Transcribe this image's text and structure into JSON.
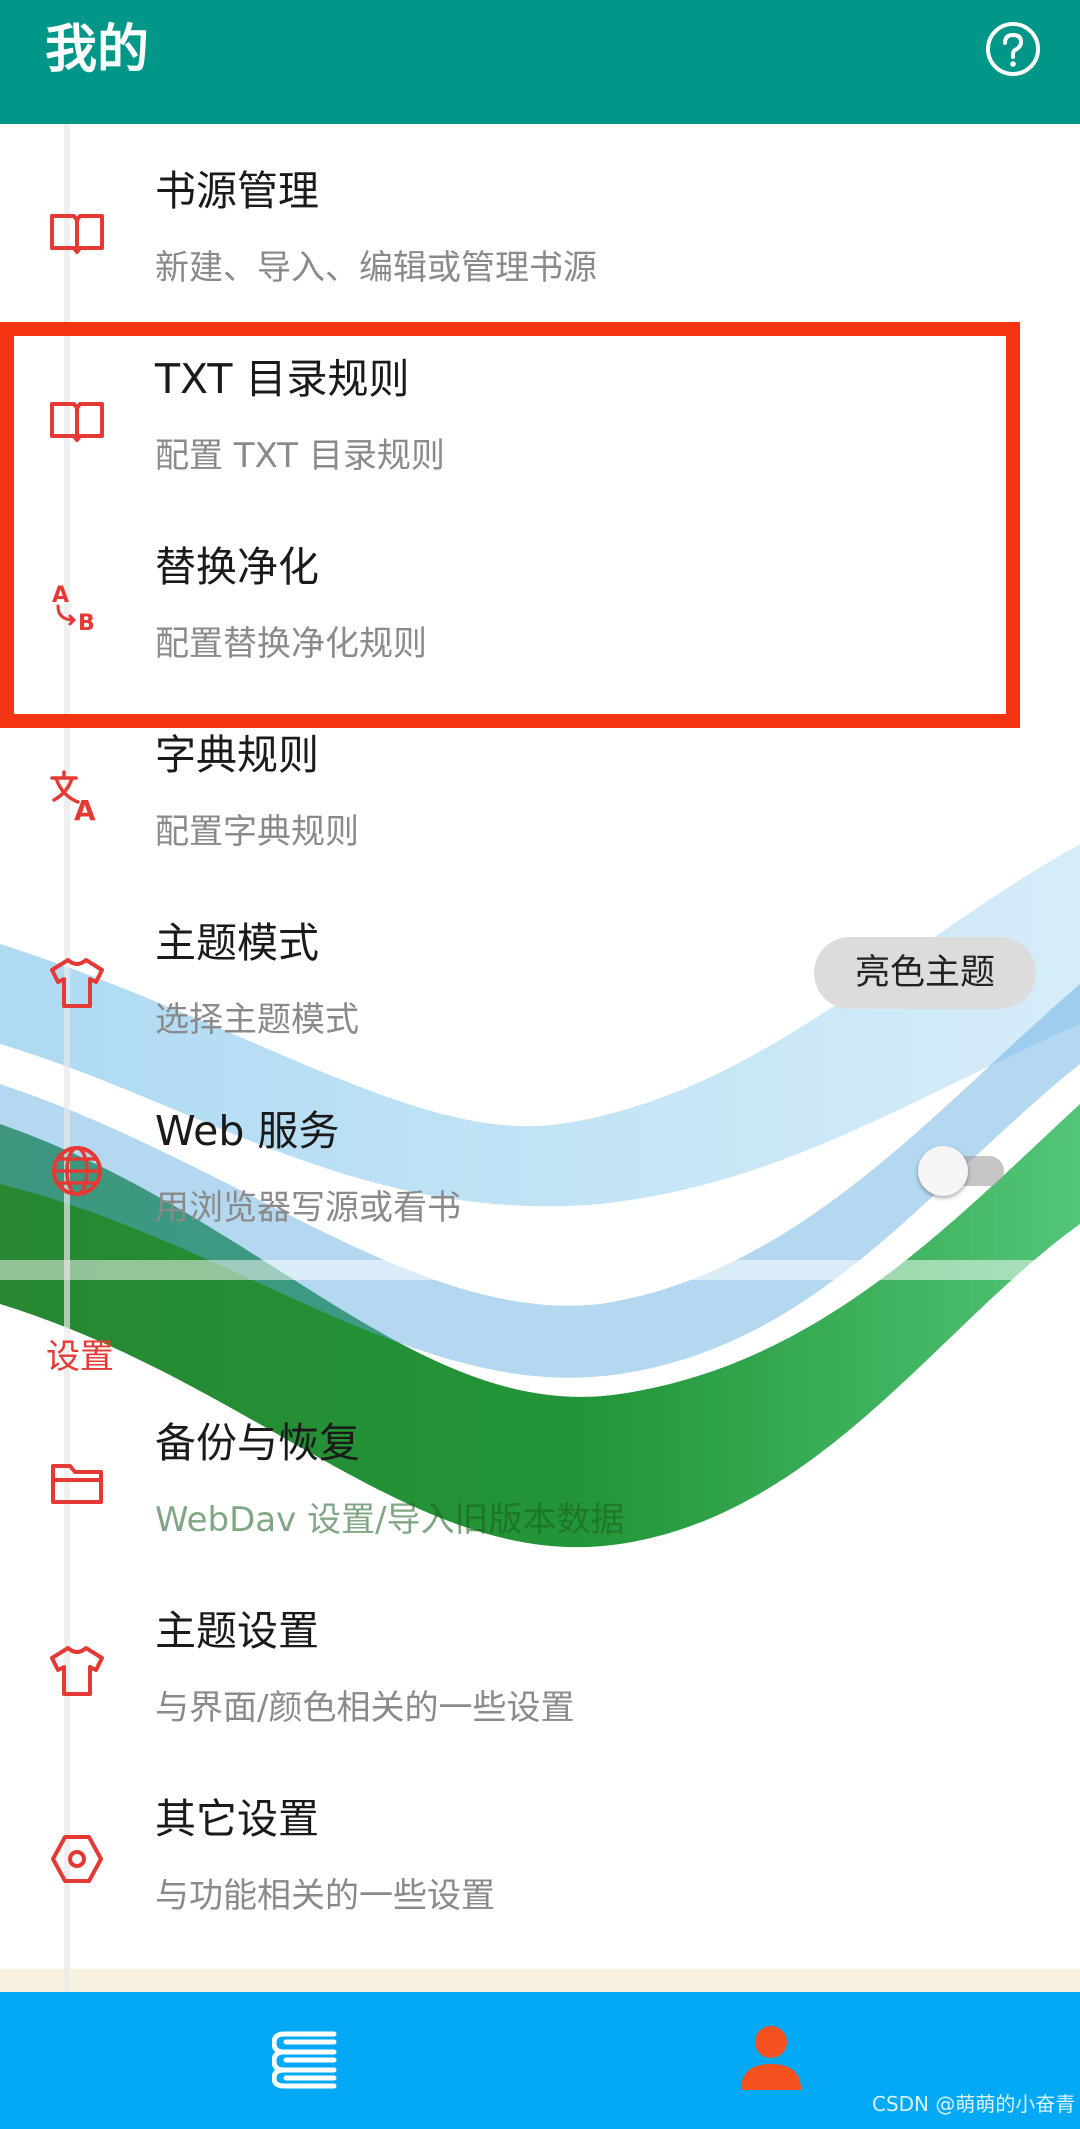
{
  "appbar": {
    "title": "我的",
    "help_icon": "help-circle-icon"
  },
  "items_top": [
    {
      "icon": "book-open-icon",
      "title": "书源管理",
      "subtitle": "新建、导入、编辑或管理书源"
    },
    {
      "icon": "book-open-icon",
      "title": "TXT 目录规则",
      "subtitle": "配置 TXT 目录规则"
    },
    {
      "icon": "a-to-b-replace-icon",
      "title": "替换净化",
      "subtitle": "配置替换净化规则"
    },
    {
      "icon": "translate-icon",
      "title": "字典规则",
      "subtitle": "配置字典规则"
    },
    {
      "icon": "tshirt-icon",
      "title": "主题模式",
      "subtitle": "选择主题模式"
    },
    {
      "icon": "globe-icon",
      "title": "Web 服务",
      "subtitle": "用浏览器写源或看书"
    }
  ],
  "theme_mode_value": "亮色主题",
  "web_service_enabled": false,
  "section": {
    "label": "设置"
  },
  "items_settings": [
    {
      "icon": "folder-icon",
      "title": "备份与恢复",
      "subtitle": "WebDav 设置/导入旧版本数据"
    },
    {
      "icon": "tshirt-icon",
      "title": "主题设置",
      "subtitle": "与界面/颜色相关的一些设置"
    },
    {
      "icon": "hexagon-settings-icon",
      "title": "其它设置",
      "subtitle": "与功能相关的一些设置"
    }
  ],
  "bottom_nav": [
    {
      "icon": "bookshelf-icon",
      "selected": false
    },
    {
      "icon": "person-icon",
      "selected": true
    }
  ],
  "watermark": "CSDN @萌萌的小奋青",
  "colors": {
    "appbar": "#009688",
    "accent": "#e53935",
    "bottom_bar": "#03a9f4",
    "highlight": "#f53411"
  }
}
